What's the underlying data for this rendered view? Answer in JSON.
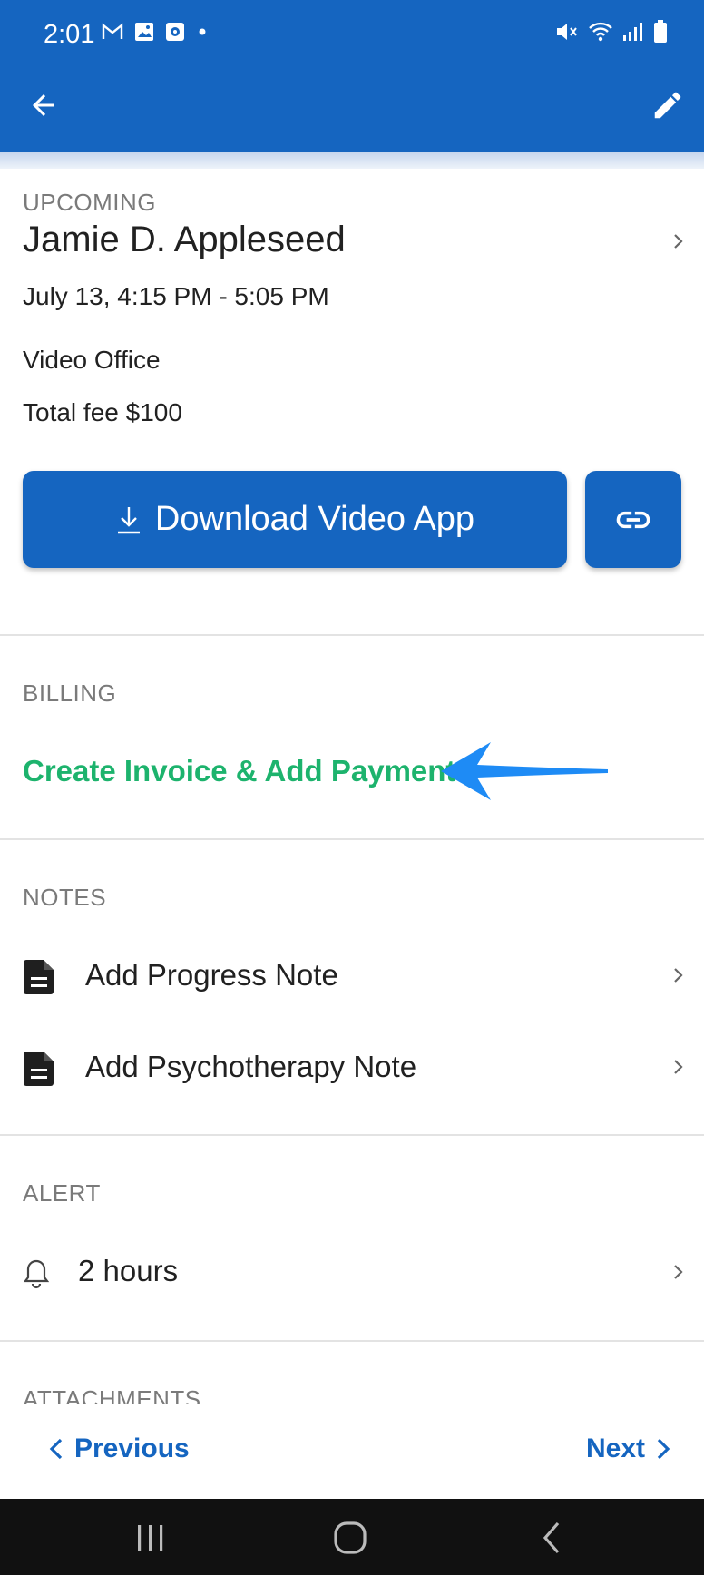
{
  "status_bar": {
    "time": "2:01",
    "left_icons": [
      "gmail-icon",
      "gallery-icon",
      "app-notification-icon",
      "dot-icon"
    ],
    "right_icons": [
      "mute-icon",
      "wifi-icon",
      "signal-icon",
      "battery-icon"
    ]
  },
  "app_bar": {
    "back_icon": "back-arrow-icon",
    "edit_icon": "edit-pencil-icon",
    "color": "#1565C0"
  },
  "appointment": {
    "status_label": "UPCOMING",
    "client_name": "Jamie D. Appleseed",
    "datetime": "July 13, 4:15 PM - 5:05 PM",
    "location": "Video Office",
    "fee": "Total fee $100",
    "download_button_label": "Download Video App",
    "link_button_icon": "link-icon"
  },
  "billing": {
    "section_label": "BILLING",
    "create_invoice_label": "Create Invoice & Add Payment",
    "link_color": "#1DB36D",
    "annotation_arrow_color": "#1E8BF5"
  },
  "notes": {
    "section_label": "NOTES",
    "items": [
      {
        "label": "Add Progress Note",
        "icon": "document-icon"
      },
      {
        "label": "Add Psychotherapy Note",
        "icon": "document-icon"
      }
    ]
  },
  "alert": {
    "section_label": "ALERT",
    "value": "2 hours",
    "icon": "bell-icon"
  },
  "attachments": {
    "section_label": "ATTACHMENTS"
  },
  "bottom_nav": {
    "previous_label": "Previous",
    "next_label": "Next"
  },
  "system_nav": [
    "recents-icon",
    "home-icon",
    "system-back-icon"
  ]
}
